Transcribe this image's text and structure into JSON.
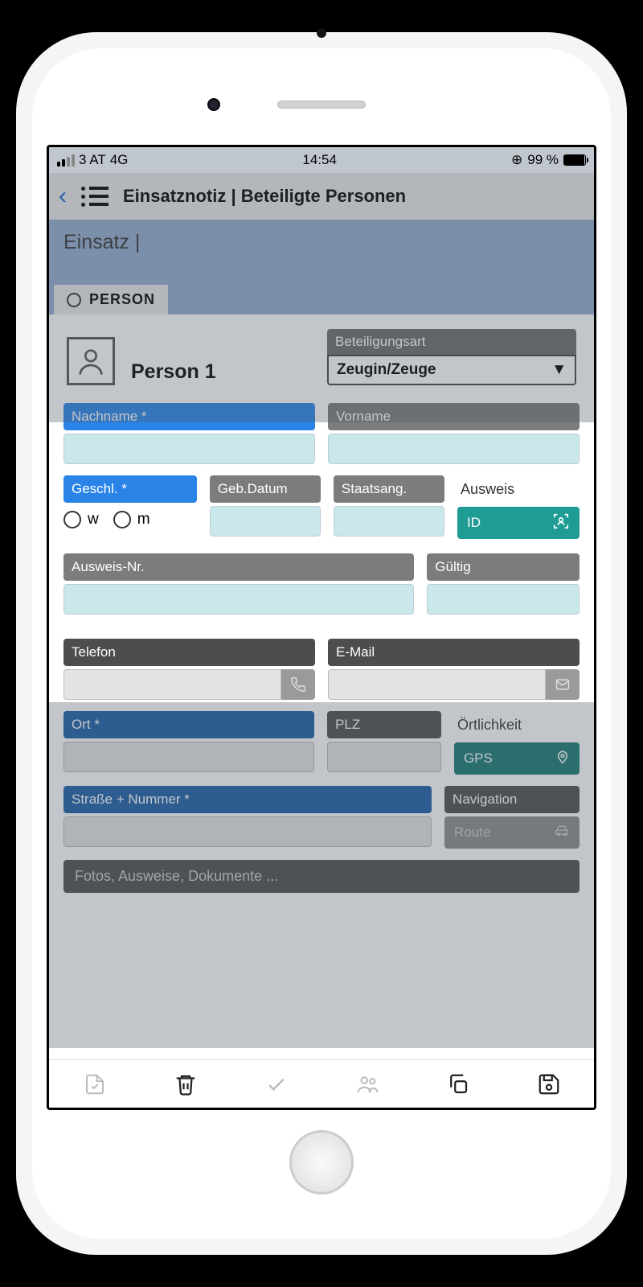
{
  "status": {
    "carrier": "3 AT",
    "net": "4G",
    "time": "14:54",
    "battery": "99 %"
  },
  "header": {
    "title": "Einsatznotiz | Beteiligte Personen"
  },
  "subheader": {
    "text": "Einsatz |"
  },
  "tab": {
    "label": "PERSON"
  },
  "person": {
    "title": "Person 1",
    "type_label": "Beteiligungsart",
    "type_value": "Zeugin/Zeuge"
  },
  "fields": {
    "nachname": "Nachname *",
    "vorname": "Vorname",
    "geschl": "Geschl. *",
    "geb": "Geb.Datum",
    "staat": "Staatsang.",
    "ausweis": "Ausweis",
    "id_btn": "ID",
    "w": "w",
    "m": "m",
    "ausweis_nr": "Ausweis-Nr.",
    "gueltig": "Gültig",
    "telefon": "Telefon",
    "email": "E-Mail",
    "ort": "Ort *",
    "plz": "PLZ",
    "oertlichkeit": "Örtlichkeit",
    "gps": "GPS",
    "strasse": "Straße + Nummer *",
    "navigation": "Navigation",
    "route": "Route",
    "fotos": "Fotos, Ausweise, Dokumente ..."
  }
}
